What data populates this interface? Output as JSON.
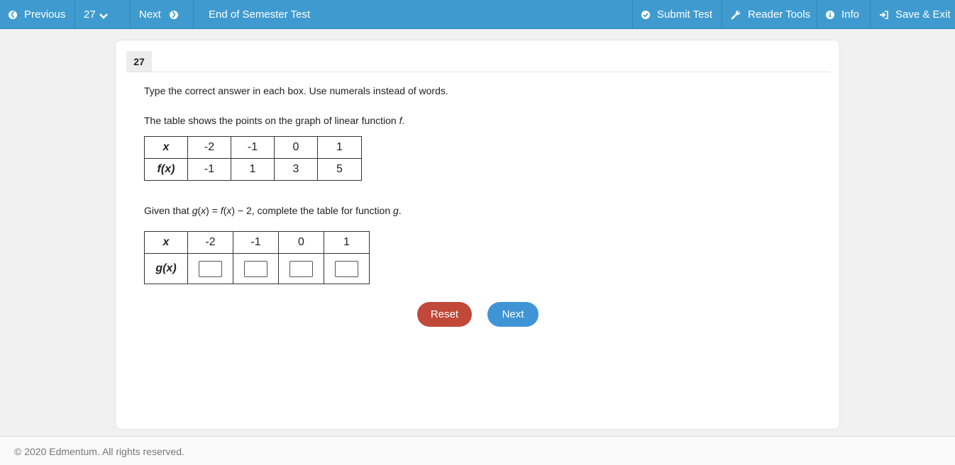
{
  "nav": {
    "previous_label": "Previous",
    "question_number": "27",
    "next_label": "Next",
    "test_title": "End of Semester Test",
    "submit_label": "Submit Test",
    "reader_tools_label": "Reader Tools",
    "info_label": "Info",
    "save_exit_label": "Save & Exit"
  },
  "question": {
    "number": "27",
    "instruction": "Type the correct answer in each box. Use numerals instead of words.",
    "table_intro": "The table shows the points on the graph of linear function ",
    "table_intro_var": "f",
    "table_intro_end": ".",
    "f_table": {
      "x_header": "x",
      "fx_header": "f(x)",
      "x_values": [
        "-2",
        "-1",
        "0",
        "1"
      ],
      "fx_values": [
        "-1",
        "1",
        "3",
        "5"
      ]
    },
    "given": {
      "prefix": "Given that ",
      "g": "g",
      "open1": "(",
      "x1": "x",
      "mid": ") = ",
      "f": "f",
      "open2": "(",
      "x2": "x",
      "rest": ") − 2, complete the table for function ",
      "g2": "g",
      "end": "."
    },
    "g_table": {
      "x_header": "x",
      "gx_header": "g(x)",
      "x_values": [
        "-2",
        "-1",
        "0",
        "1"
      ],
      "gx_answers": [
        "",
        "",
        "",
        ""
      ]
    }
  },
  "buttons": {
    "reset_label": "Reset",
    "next_label": "Next"
  },
  "footer": {
    "copyright": "© 2020 Edmentum. All rights reserved."
  },
  "colors": {
    "topbar": "#3f9bcf",
    "reset_button": "#c0493a",
    "next_button": "#3f94d6"
  }
}
